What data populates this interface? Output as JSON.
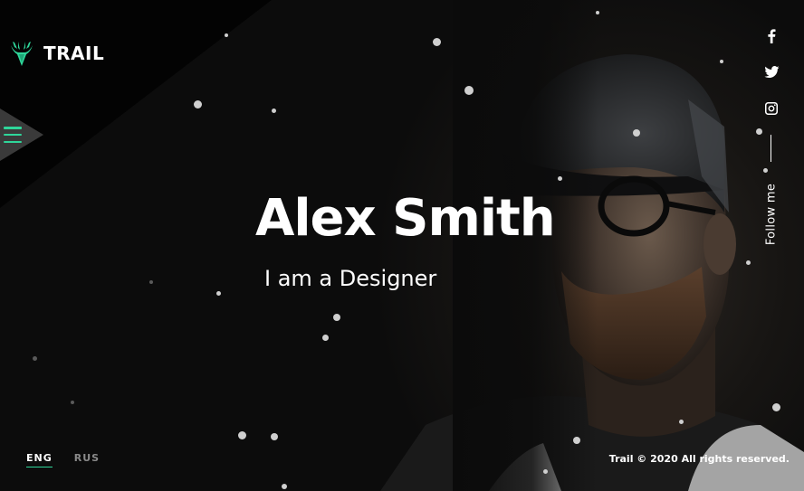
{
  "brand": {
    "name": "TRAIL",
    "icon": "deer-antler-icon",
    "accent_color": "#2fd69a"
  },
  "nav": {
    "menu_icon": "hamburger-menu-icon"
  },
  "hero": {
    "name": "Alex Smith",
    "prefix": "I am a",
    "role": "Designer"
  },
  "social": {
    "items": [
      {
        "icon": "facebook-icon",
        "label": "Facebook"
      },
      {
        "icon": "twitter-icon",
        "label": "Twitter"
      },
      {
        "icon": "instagram-icon",
        "label": "Instagram"
      }
    ],
    "follow_label": "Follow me"
  },
  "footer": {
    "languages": [
      {
        "code": "ENG",
        "active": true
      },
      {
        "code": "RUS",
        "active": false
      }
    ],
    "copyright": "Trail © 2020 All rights reserved."
  },
  "colors": {
    "background": "#0b0b0b",
    "text": "#ffffff",
    "muted": "#8a8a8a"
  }
}
